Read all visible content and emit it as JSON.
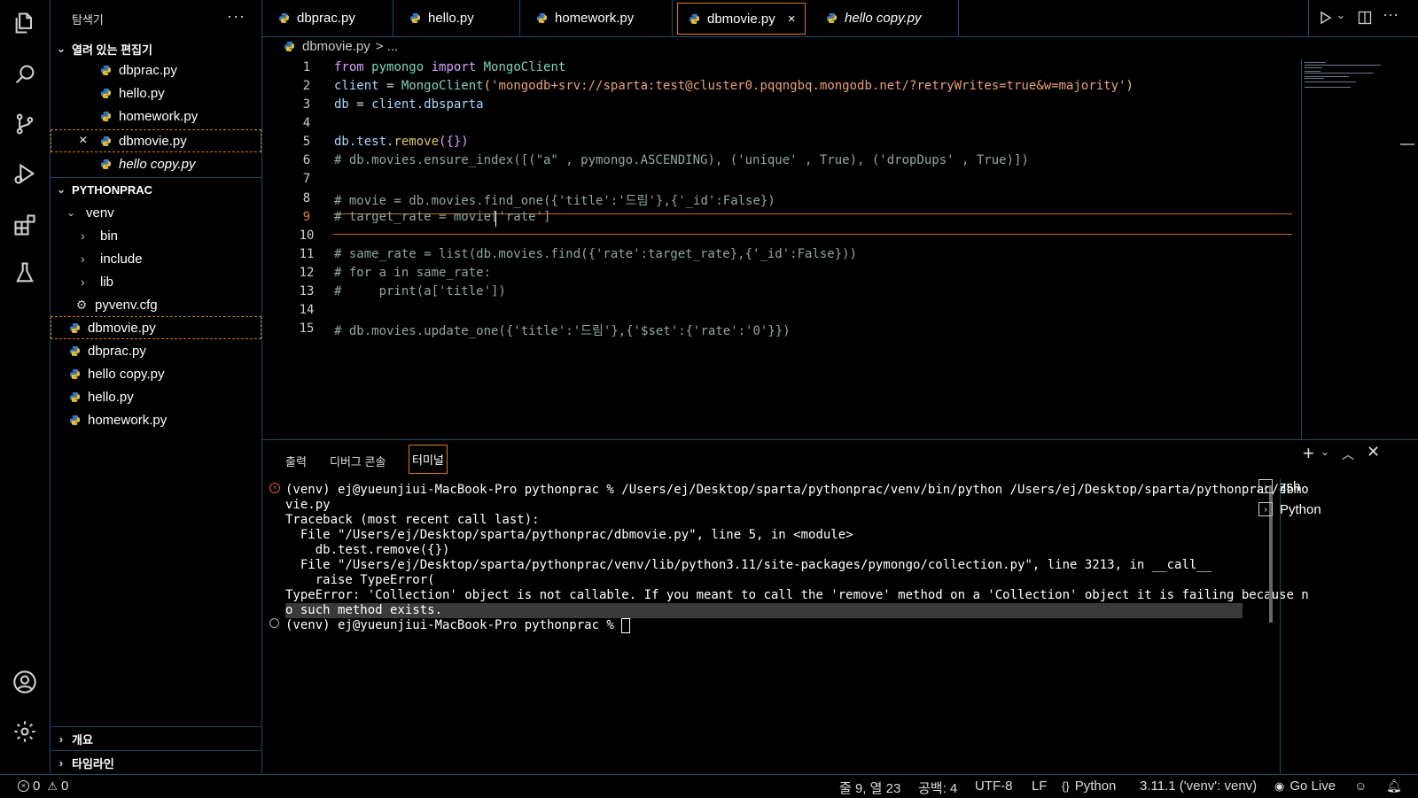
{
  "sidebar": {
    "title": "탐색기",
    "more": "···",
    "open_editors_title": "열려 있는 편집기",
    "open_editors": [
      "dbprac.py",
      "hello.py",
      "homework.py",
      "dbmovie.py",
      "hello copy.py"
    ],
    "close_glyph": "×",
    "project_title": "PYTHONPRAC",
    "tree": {
      "venv": "venv",
      "bin": "bin",
      "include": "include",
      "lib": "lib",
      "pyvenv": "pyvenv.cfg",
      "files": [
        "dbmovie.py",
        "dbprac.py",
        "hello copy.py",
        "hello.py",
        "homework.py"
      ]
    },
    "outline": "개요",
    "timeline": "타임라인"
  },
  "tabs": [
    "dbprac.py",
    "hello.py",
    "homework.py",
    "dbmovie.py",
    "hello copy.py"
  ],
  "active_tab_close": "×",
  "breadcrumb": {
    "file": "dbmovie.py",
    "rest": "> ..."
  },
  "editor": {
    "line_numbers": [
      "1",
      "2",
      "3",
      "4",
      "5",
      "6",
      "7",
      "8",
      "9",
      "10",
      "11",
      "12",
      "13",
      "14",
      "15"
    ],
    "lines": {
      "l1_kw1": "from",
      "l1_mod": "pymongo",
      "l1_kw2": "import",
      "l1_cls": "MongoClient",
      "l2_var": "client",
      "l2_op": " = ",
      "l2_cls": "MongoClient",
      "l2_p1": "(",
      "l2_str": "'mongodb+srv://sparta:test@cluster0.pqqngbq.mongodb.net/?retryWrites=true&w=majority'",
      "l2_p2": ")",
      "l3_var": "db",
      "l3_op": " = ",
      "l3_var2": "client",
      "l3_rest": ".dbsparta",
      "l5_var": "db",
      "l5_rest": ".test.",
      "l5_fn": "remove",
      "l5_args": "({})",
      "l6": "# db.movies.ensure_index([(\"a\" , pymongo.ASCENDING), ('unique' , True), ('dropDups' , True)])",
      "l8": "# movie = db.movies.find_one({'title':'드림'},{'_id':False})",
      "l9": "# target_rate = movie['rate']",
      "l11": "# same_rate = list(db.movies.find({'rate':target_rate},{'_id':False}))",
      "l12": "# for a in same_rate:",
      "l13": "#     print(a['title'])",
      "l15": "# db.movies.update_one({'title':'드림'},{'$set':{'rate':'0'}})"
    }
  },
  "panel": {
    "tabs": [
      "출력",
      "디버그 콘솔",
      "터미널"
    ],
    "terminal_lines": [
      "(venv) ej@yueunjiui-MacBook-Pro pythonprac % /Users/ej/Desktop/sparta/pythonprac/venv/bin/python /Users/ej/Desktop/sparta/pythonprac/dbmo",
      "vie.py",
      "Traceback (most recent call last):",
      "  File \"/Users/ej/Desktop/sparta/pythonprac/dbmovie.py\", line 5, in <module>",
      "    db.test.remove({})",
      "  File \"/Users/ej/Desktop/sparta/pythonprac/venv/lib/python3.11/site-packages/pymongo/collection.py\", line 3213, in __call__",
      "    raise TypeError(",
      "TypeError: 'Collection' object is not callable. If you meant to call the 'remove' method on a 'Collection' object it is failing because n",
      "o such method exists.",
      "(venv) ej@yueunjiui-MacBook-Pro pythonprac % "
    ],
    "terminals": [
      "zsh",
      "Python"
    ]
  },
  "status": {
    "errors": "0",
    "warnings": "0",
    "position": "줄 9, 열 23",
    "spaces": "공백: 4",
    "encoding": "UTF-8",
    "eol": "LF",
    "language": "Python",
    "interpreter": "3.11.1 ('venv': venv)",
    "golive": "Go Live"
  },
  "colors": {
    "accent": "#e07a1f",
    "border": "#1e4a66",
    "error": "#e0524f"
  }
}
